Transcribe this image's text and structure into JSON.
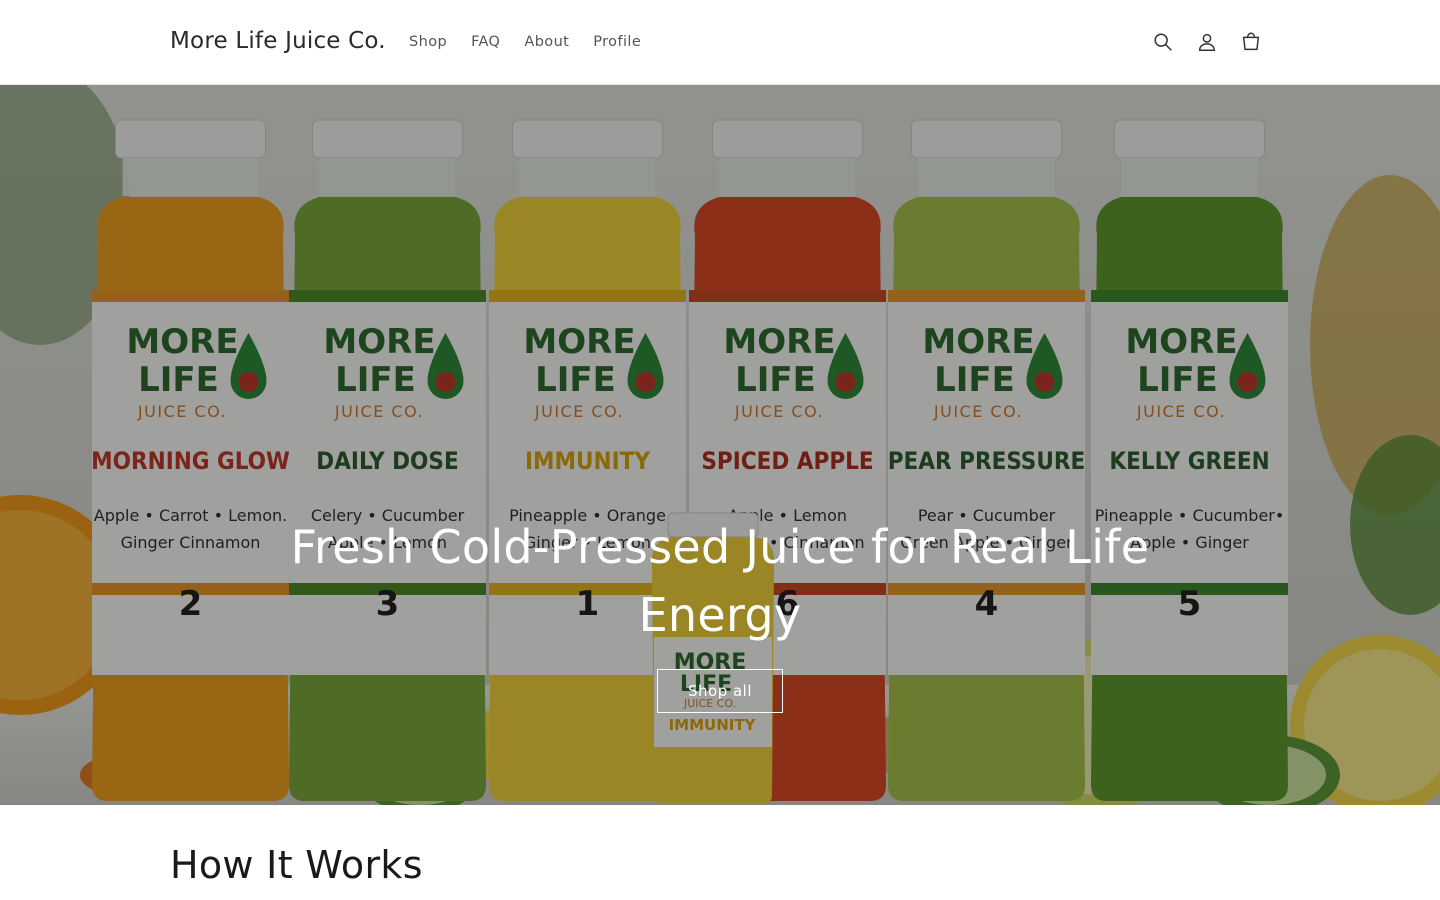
{
  "header": {
    "logo": "More Life Juice Co.",
    "nav": [
      "Shop",
      "FAQ",
      "About",
      "Profile"
    ],
    "icons": [
      "search-icon",
      "account-icon",
      "cart-icon"
    ]
  },
  "hero": {
    "title": "Fresh Cold-Pressed Juice for Real Life Energy",
    "button": "Shop all",
    "bottles": [
      {
        "brand_line1": "MORE",
        "brand_line2": "LIFE",
        "brand_line3": "JUICE CO.",
        "name": "MORNING GLOW",
        "ingredients_1": "Apple • Carrot • Lemon.",
        "ingredients_2": "Ginger Cinnamon",
        "number": "2",
        "name_color": "#c0392b",
        "juice_color": "#f0a020",
        "band_color": "#e8962a"
      },
      {
        "brand_line1": "MORE",
        "brand_line2": "LIFE",
        "brand_line3": "JUICE CO.",
        "name": "DAILY DOSE",
        "ingredients_1": "Celery • Cucumber",
        "ingredients_2": "Apple • Lemon",
        "number": "3",
        "name_color": "#2e5e2e",
        "juice_color": "#7aa93a",
        "band_color": "#4f8a2a"
      },
      {
        "brand_line1": "MORE",
        "brand_line2": "LIFE",
        "brand_line3": "JUICE CO.",
        "name": "IMMUNITY",
        "ingredients_1": "Pineapple • Orange",
        "ingredients_2": "Ginger • Lemon",
        "number": "1",
        "name_color": "#d9a40a",
        "juice_color": "#f2d23a",
        "band_color": "#e6b81e"
      },
      {
        "brand_line1": "MORE",
        "brand_line2": "LIFE",
        "brand_line3": "JUICE CO.",
        "name": "SPICED APPLE",
        "ingredients_1": "Apple • Lemon",
        "ingredients_2": "Ginger • Cinnamon",
        "number": "6",
        "name_color": "#b03020",
        "juice_color": "#d94a28",
        "band_color": "#c94a24"
      },
      {
        "brand_line1": "MORE",
        "brand_line2": "LIFE",
        "brand_line3": "JUICE CO.",
        "name": "PEAR PRESSURE",
        "ingredients_1": "Pear • Cucumber",
        "ingredients_2": "Green Apple • Ginger",
        "number": "4",
        "name_color": "#2e5e2e",
        "juice_color": "#a7c24a",
        "band_color": "#e89a2a"
      },
      {
        "brand_line1": "MORE",
        "brand_line2": "LIFE",
        "brand_line3": "JUICE CO.",
        "name": "KELLY GREEN",
        "ingredients_1": "Pineapple • Cucumber•",
        "ingredients_2": "Apple • Ginger",
        "number": "5",
        "name_color": "#2e5e2e",
        "juice_color": "#5e9a2e",
        "band_color": "#3f8a30"
      }
    ],
    "small_bottle": {
      "brand_line1": "MORE",
      "brand_line2": "LIFE",
      "brand_line3": "JUICE CO.",
      "name": "IMMUNITY"
    }
  },
  "section": {
    "title": "How It Works"
  }
}
